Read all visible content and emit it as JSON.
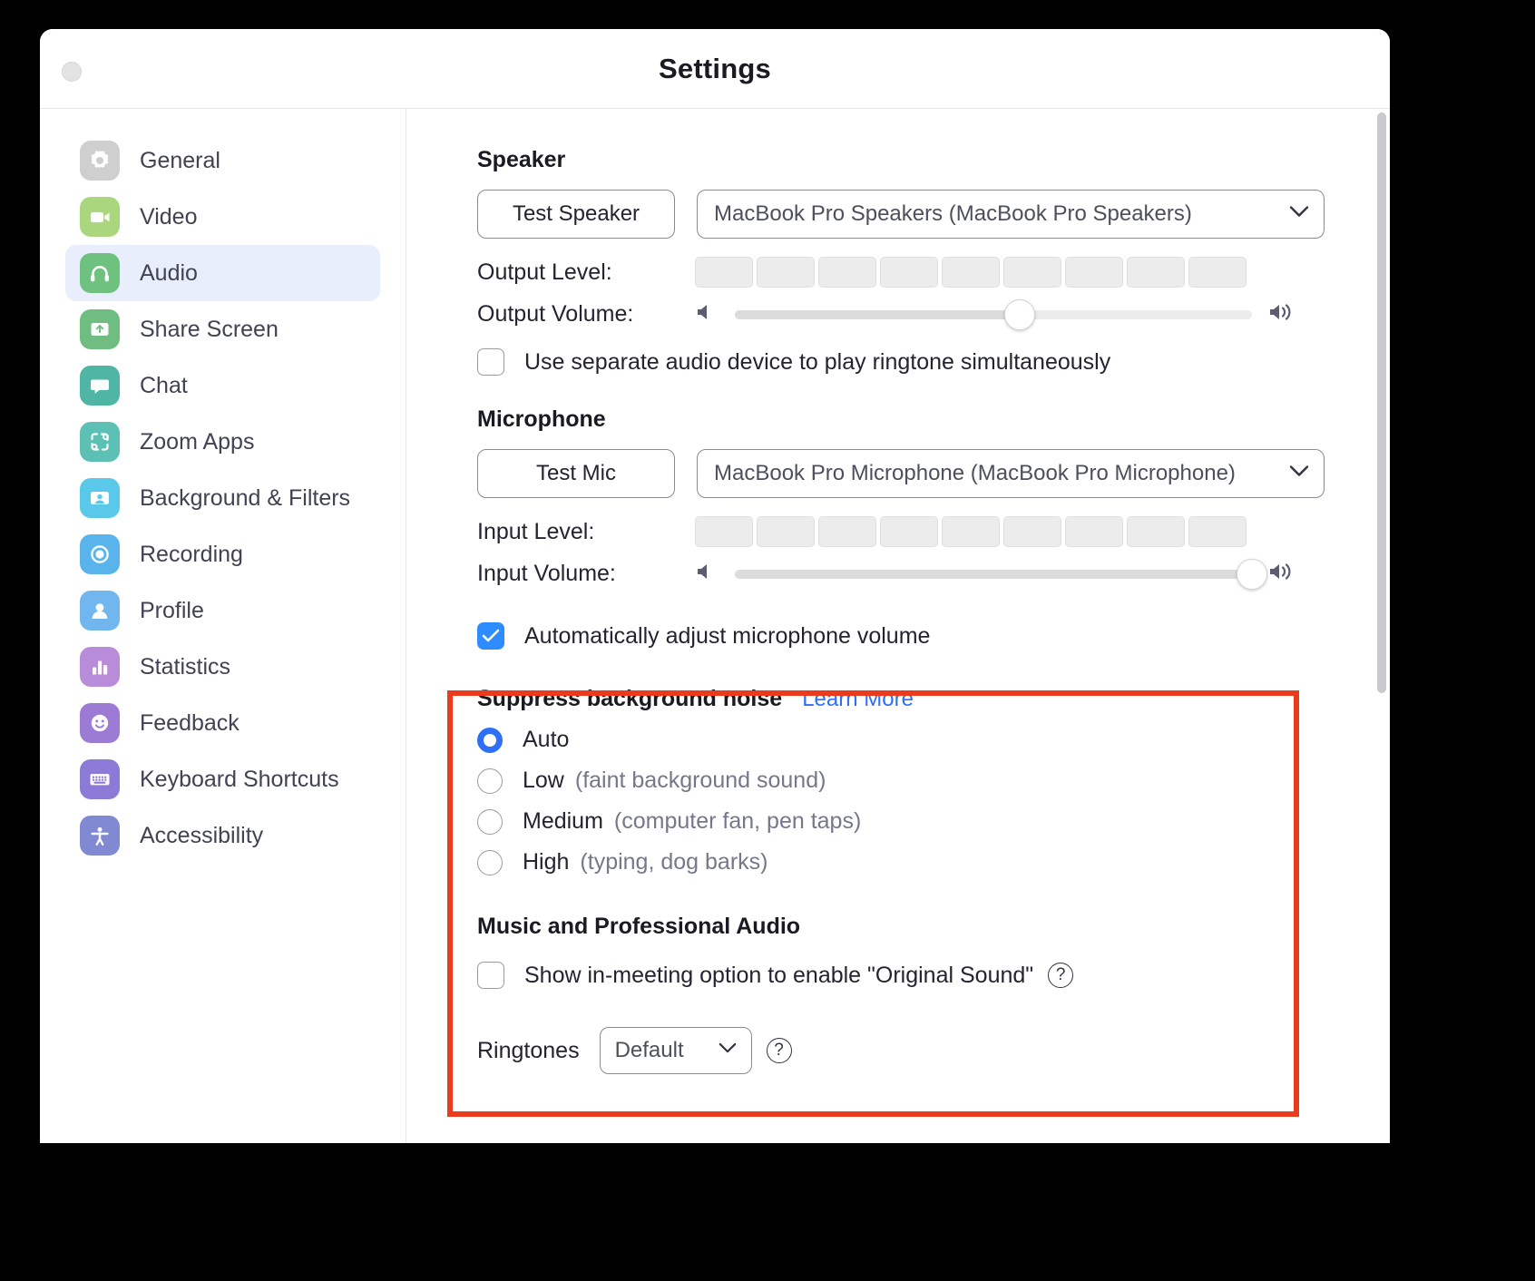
{
  "window": {
    "title": "Settings",
    "close_button": "close"
  },
  "sidebar": {
    "items": [
      {
        "label": "General",
        "icon": "gear-icon",
        "color": "#cfcfcf",
        "active": false
      },
      {
        "label": "Video",
        "icon": "video-camera-icon",
        "color": "#aad77d",
        "active": false
      },
      {
        "label": "Audio",
        "icon": "headphones-icon",
        "color": "#6ec17e",
        "active": true
      },
      {
        "label": "Share Screen",
        "icon": "share-screen-icon",
        "color": "#6fbd81",
        "active": false
      },
      {
        "label": "Chat",
        "icon": "chat-bubble-icon",
        "color": "#4fb5a4",
        "active": false
      },
      {
        "label": "Zoom Apps",
        "icon": "zoom-apps-icon",
        "color": "#5cc0b4",
        "active": false
      },
      {
        "label": "Background & Filters",
        "icon": "person-frame-icon",
        "color": "#5ac8e8",
        "active": false
      },
      {
        "label": "Recording",
        "icon": "record-circle-icon",
        "color": "#5ab4ec",
        "active": false
      },
      {
        "label": "Profile",
        "icon": "person-icon",
        "color": "#72b6f0",
        "active": false
      },
      {
        "label": "Statistics",
        "icon": "bar-chart-icon",
        "color": "#b98cd9",
        "active": false
      },
      {
        "label": "Feedback",
        "icon": "smiley-icon",
        "color": "#9b7bd4",
        "active": false
      },
      {
        "label": "Keyboard Shortcuts",
        "icon": "keyboard-icon",
        "color": "#8b7bd6",
        "active": false
      },
      {
        "label": "Accessibility",
        "icon": "accessibility-icon",
        "color": "#8189d3",
        "active": false
      }
    ]
  },
  "main": {
    "speaker": {
      "heading": "Speaker",
      "test_button": "Test Speaker",
      "device": "MacBook Pro Speakers (MacBook Pro Speakers)",
      "output_level_label": "Output Level:",
      "output_level_segments": 9,
      "output_level_value": 0,
      "output_volume_label": "Output Volume:",
      "output_volume_percent": 55,
      "separate_device_checkbox": {
        "label": "Use separate audio device to play ringtone simultaneously",
        "checked": false
      }
    },
    "microphone": {
      "heading": "Microphone",
      "test_button": "Test Mic",
      "device": "MacBook Pro Microphone (MacBook Pro Microphone)",
      "input_level_label": "Input Level:",
      "input_level_segments": 9,
      "input_level_value": 0,
      "input_volume_label": "Input Volume:",
      "input_volume_percent": 100
    },
    "highlighted": {
      "auto_adjust_checkbox": {
        "label": "Automatically adjust microphone volume",
        "checked": true
      },
      "suppress_noise": {
        "heading": "Suppress background noise",
        "learn_more": "Learn More",
        "options": [
          {
            "label": "Auto",
            "hint": "",
            "selected": true
          },
          {
            "label": "Low",
            "hint": "(faint background sound)",
            "selected": false
          },
          {
            "label": "Medium",
            "hint": "(computer fan, pen taps)",
            "selected": false
          },
          {
            "label": "High",
            "hint": "(typing, dog barks)",
            "selected": false
          }
        ]
      },
      "music_pro_audio": {
        "heading": "Music and Professional Audio",
        "original_sound_checkbox": {
          "label": "Show in-meeting option to enable \"Original Sound\"",
          "checked": false,
          "help_icon": "question-circle-icon"
        }
      }
    },
    "ringtones": {
      "label": "Ringtones",
      "value": "Default",
      "help_icon": "question-circle-icon"
    }
  },
  "colors": {
    "accent_blue": "#2d8cff",
    "radio_blue": "#2d6ff7",
    "link_blue": "#2d6ff7",
    "highlight_red": "#ea3c1c",
    "active_nav_bg": "#e8eefb"
  }
}
